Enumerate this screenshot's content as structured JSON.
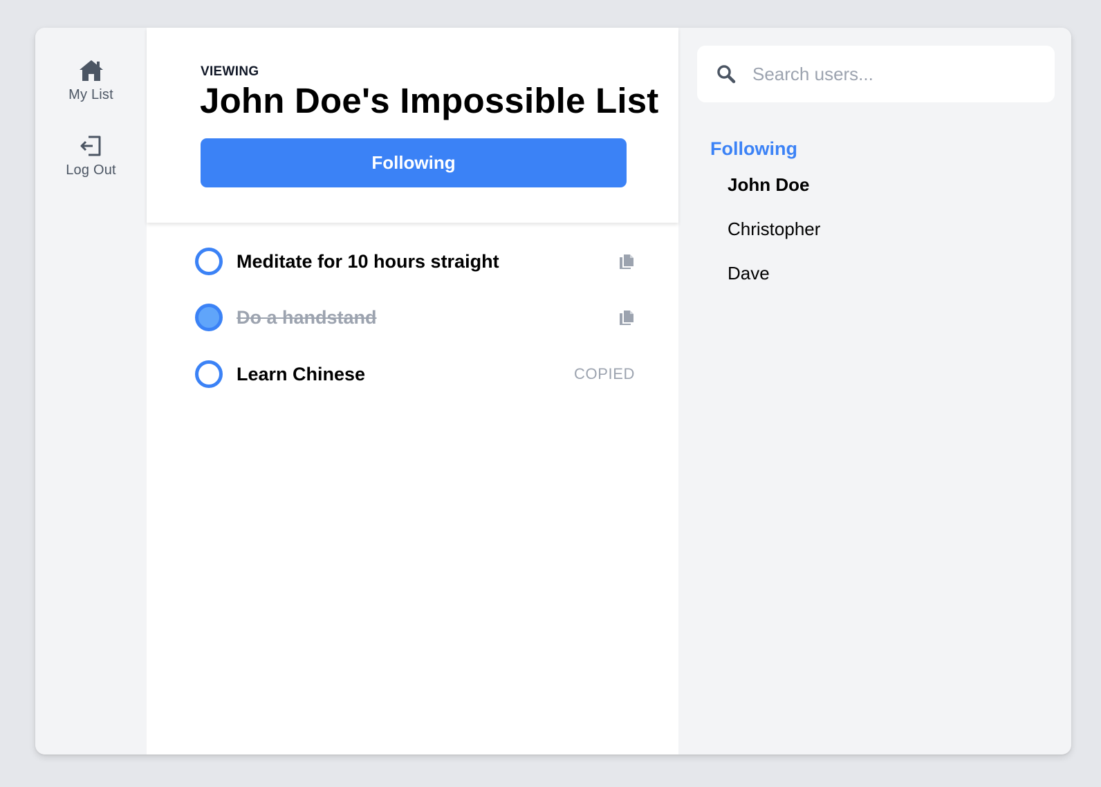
{
  "nav": {
    "items": [
      {
        "label": "My List",
        "icon": "home-icon"
      },
      {
        "label": "Log Out",
        "icon": "logout-icon"
      }
    ]
  },
  "header": {
    "eyebrow": "VIEWING",
    "title": "John Doe's Impossible List",
    "follow_button_label": "Following"
  },
  "list": {
    "items": [
      {
        "text": "Meditate for 10 hours straight",
        "completed": false,
        "action": "copy-icon"
      },
      {
        "text": "Do a handstand",
        "completed": true,
        "action": "copy-icon"
      },
      {
        "text": "Learn Chinese",
        "completed": false,
        "action_text": "COPIED"
      }
    ]
  },
  "sidebar": {
    "search": {
      "placeholder": "Search users...",
      "value": ""
    },
    "following_heading": "Following",
    "users": [
      {
        "name": "John Doe",
        "active": true
      },
      {
        "name": "Christopher",
        "active": false
      },
      {
        "name": "Dave",
        "active": false
      }
    ]
  },
  "colors": {
    "accent": "#3b82f6",
    "accent_light": "#60a5fa",
    "muted": "#9ca3af",
    "background": "#e5e7eb",
    "panel": "#f3f4f6"
  }
}
